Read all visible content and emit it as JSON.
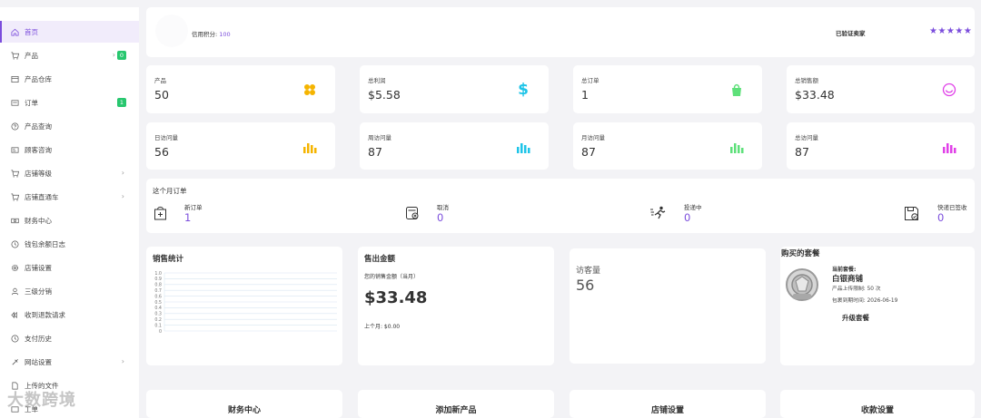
{
  "sidebar": {
    "items": [
      {
        "label": "首页",
        "icon": "home-icon",
        "active": true
      },
      {
        "label": "产品",
        "icon": "cart-icon",
        "badge": "0"
      },
      {
        "label": "产品仓库",
        "icon": "storage-icon"
      },
      {
        "label": "订单",
        "icon": "order-icon",
        "badge": "1"
      },
      {
        "label": "产品查询",
        "icon": "question-icon"
      },
      {
        "label": "顾客咨询",
        "icon": "consult-icon"
      },
      {
        "label": "店铺等级",
        "icon": "cart-icon"
      },
      {
        "label": "店铺直通车",
        "icon": "cart-icon"
      },
      {
        "label": "财务中心",
        "icon": "money-icon"
      },
      {
        "label": "钱包余额日志",
        "icon": "history-icon"
      },
      {
        "label": "店铺设置",
        "icon": "gear-icon"
      },
      {
        "label": "三级分销",
        "icon": "user-icon"
      },
      {
        "label": "收到退款请求",
        "icon": "refund-icon"
      },
      {
        "label": "支付历史",
        "icon": "history-icon"
      },
      {
        "label": "网站设置",
        "icon": "tools-icon"
      },
      {
        "label": "上传的文件",
        "icon": "file-icon"
      },
      {
        "label": "工单",
        "icon": "ticket-icon"
      }
    ]
  },
  "header": {
    "credit_label": "信用积分:",
    "credit_value": "100",
    "verified_label": "已验证卖家",
    "stars": "★★★★★",
    "star_color": "#7b4ddc"
  },
  "stats_row1": [
    {
      "label": "产品",
      "value": "50",
      "icon": "grid-icon",
      "color": "#f5b400"
    },
    {
      "label": "总利润",
      "value": "$5.58",
      "icon": "dollar-icon",
      "color": "#1ec4e8"
    },
    {
      "label": "总订单",
      "value": "1",
      "icon": "bag-icon",
      "color": "#5ee07a"
    },
    {
      "label": "总销售额",
      "value": "$33.48",
      "icon": "smile-icon",
      "color": "#e040e8"
    }
  ],
  "stats_row2": [
    {
      "label": "日访问量",
      "value": "56",
      "icon": "bar-icon",
      "color": "#f5b400"
    },
    {
      "label": "周访问量",
      "value": "87",
      "icon": "bar-icon",
      "color": "#1ec4e8"
    },
    {
      "label": "月访问量",
      "value": "87",
      "icon": "bar-icon",
      "color": "#5ee07a"
    },
    {
      "label": "总访问量",
      "value": "87",
      "icon": "bar-icon",
      "color": "#e040e8"
    }
  ],
  "monthly_orders": {
    "title": "这个月订单",
    "items": [
      {
        "label": "新订单",
        "value": "1",
        "icon": "new-order-icon"
      },
      {
        "label": "取消",
        "value": "0",
        "icon": "cancel-icon"
      },
      {
        "label": "投递中",
        "value": "0",
        "icon": "runner-icon"
      },
      {
        "label": "快递已签收",
        "value": "0",
        "icon": "signed-icon"
      }
    ]
  },
  "sales_stats": {
    "title": "销售统计"
  },
  "chart_data": {
    "type": "line",
    "title": "销售统计",
    "x": [],
    "series": [],
    "ylim": [
      0,
      1.0
    ],
    "y_ticks": [
      "1.0",
      "0.9",
      "0.8",
      "0.7",
      "0.6",
      "0.5",
      "0.4",
      "0.3",
      "0.2",
      "0.1",
      "0"
    ],
    "grid": true
  },
  "sold_amount": {
    "title": "售出金额",
    "subtitle": "您的销售金额（当月）",
    "value": "$33.48",
    "last_month": "上个月: $0.00"
  },
  "visitors": {
    "label": "访客量",
    "value": "56"
  },
  "package": {
    "title": "购买的套餐",
    "current_label": "当前套餐:",
    "name": "白银商铺",
    "upload_limit": "产品上传限制: 50 次",
    "expiry": "包裹到期时间: 2026-06-19",
    "upgrade": "升级套餐"
  },
  "bottom_links": [
    "财务中心",
    "添加新产品",
    "店铺设置",
    "收款设置"
  ],
  "watermark": "大数跨境"
}
